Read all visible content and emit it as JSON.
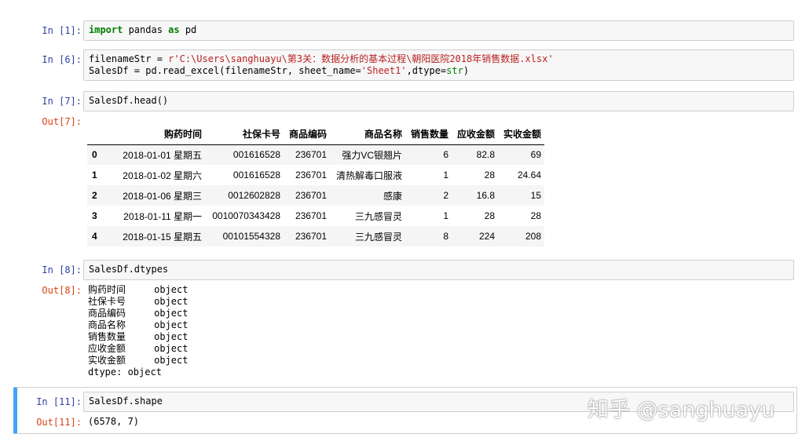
{
  "cells": [
    {
      "in_prompt": "In  [1]:",
      "code_parts": [
        "import",
        " pandas ",
        "as",
        " pd"
      ]
    },
    {
      "in_prompt": "In  [6]:",
      "line1": [
        "filenameStr = ",
        "r'C:\\Users\\sanghuayu\\第3关：数据分析的基本过程\\朝阳医院2018年销售数据.xlsx'"
      ],
      "line2": [
        "SalesDf = pd.read_excel(filenameStr, sheet_name=",
        "'Sheet1'",
        ",dtype=",
        "str",
        ")"
      ]
    },
    {
      "in_prompt": "In  [7]:",
      "code": "SalesDf.head()",
      "out_prompt": "Out[7]:"
    },
    {
      "in_prompt": "In  [8]:",
      "code": "SalesDf.dtypes",
      "out_prompt": "Out[8]:",
      "output_lines": [
        "购药时间     object",
        "社保卡号     object",
        "商品编码     object",
        "商品名称     object",
        "销售数量     object",
        "应收金额     object",
        "实收金额     object",
        "dtype: object"
      ]
    },
    {
      "in_prompt": "In  [11]:",
      "code": "SalesDf.shape",
      "out_prompt": "Out[11]:",
      "output": "(6578, 7)"
    }
  ],
  "table": {
    "columns": [
      "",
      "购药时间",
      "社保卡号",
      "商品编码",
      "商品名称",
      "销售数量",
      "应收金额",
      "实收金额"
    ],
    "rows": [
      [
        "0",
        "2018-01-01 星期五",
        "001616528",
        "236701",
        "强力VC银翘片",
        "6",
        "82.8",
        "69"
      ],
      [
        "1",
        "2018-01-02 星期六",
        "001616528",
        "236701",
        "清热解毒口服液",
        "1",
        "28",
        "24.64"
      ],
      [
        "2",
        "2018-01-06 星期三",
        "0012602828",
        "236701",
        "感康",
        "2",
        "16.8",
        "15"
      ],
      [
        "3",
        "2018-01-11 星期一",
        "0010070343428",
        "236701",
        "三九感冒灵",
        "1",
        "28",
        "28"
      ],
      [
        "4",
        "2018-01-15 星期五",
        "00101554328",
        "236701",
        "三九感冒灵",
        "8",
        "224",
        "208"
      ]
    ]
  },
  "watermark": "知乎 @sanghuayu"
}
